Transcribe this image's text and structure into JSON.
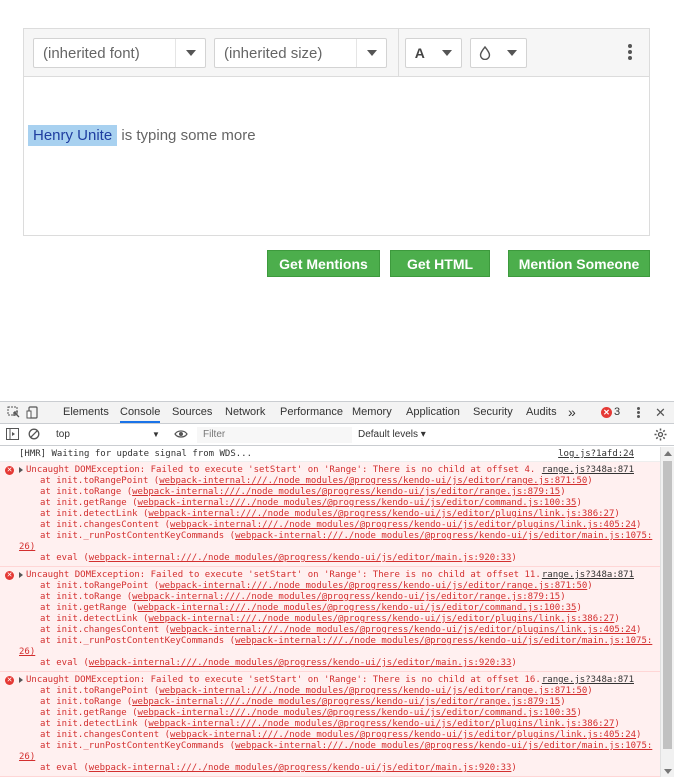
{
  "editor": {
    "font_dropdown": "(inherited font)",
    "size_dropdown": "(inherited size)",
    "fore_color_icon": "A",
    "mention_name": "Henry Unite",
    "content_text": " is typing some more"
  },
  "buttons": {
    "get_mentions": "Get Mentions",
    "get_html": "Get HTML",
    "mention_someone": "Mention Someone"
  },
  "devtools": {
    "tabs": [
      "Elements",
      "Console",
      "Sources",
      "Network",
      "Performance",
      "Memory",
      "Application",
      "Security",
      "Audits"
    ],
    "more_tabs": "»",
    "error_count": "3",
    "close": "✕",
    "context": "top",
    "filter_placeholder": "Filter",
    "levels": "Default levels ▾",
    "info_line": {
      "text": "[HMR] Waiting for update signal from WDS...",
      "src": "log.js?1afd:24"
    },
    "errors": [
      {
        "message": "Uncaught DOMException: Failed to execute 'setStart' on 'Range': There is no child at offset 4.",
        "src": "range.js?348a:871",
        "stack": [
          {
            "pre": "at init.toRangePoint (",
            "link": "webpack-internal:///./node_modules/@progress/kendo-ui/js/editor/range.js:871:50",
            "post": ")"
          },
          {
            "pre": "at init.toRange (",
            "link": "webpack-internal:///./node_modules/@progress/kendo-ui/js/editor/range.js:879:15",
            "post": ")"
          },
          {
            "pre": "at init.getRange (",
            "link": "webpack-internal:///./node_modules/@progress/kendo-ui/js/editor/command.js:100:35",
            "post": ")"
          },
          {
            "pre": "at init.detectLink (",
            "link": "webpack-internal:///./node_modules/@progress/kendo-ui/js/editor/plugins/link.js:386:27",
            "post": ")"
          },
          {
            "pre": "at init.changesContent (",
            "link": "webpack-internal:///./node_modules/@progress/kendo-ui/js/editor/plugins/link.js:405:24",
            "post": ")"
          },
          {
            "pre": "at init._runPostContentKeyCommands (",
            "link": "webpack-internal:///./node_modules/@progress/kendo-ui/js/editor/main.js:1075:",
            "post": ""
          },
          {
            "wrap": "26)"
          },
          {
            "pre": "at eval (",
            "link": "webpack-internal:///./node_modules/@progress/kendo-ui/js/editor/main.js:920:33",
            "post": ")"
          }
        ]
      },
      {
        "message": "Uncaught DOMException: Failed to execute 'setStart' on 'Range': There is no child at offset 11.",
        "src": "range.js?348a:871",
        "stack": [
          {
            "pre": "at init.toRangePoint (",
            "link": "webpack-internal:///./node_modules/@progress/kendo-ui/js/editor/range.js:871:50",
            "post": ")"
          },
          {
            "pre": "at init.toRange (",
            "link": "webpack-internal:///./node_modules/@progress/kendo-ui/js/editor/range.js:879:15",
            "post": ")"
          },
          {
            "pre": "at init.getRange (",
            "link": "webpack-internal:///./node_modules/@progress/kendo-ui/js/editor/command.js:100:35",
            "post": ")"
          },
          {
            "pre": "at init.detectLink (",
            "link": "webpack-internal:///./node_modules/@progress/kendo-ui/js/editor/plugins/link.js:386:27",
            "post": ")"
          },
          {
            "pre": "at init.changesContent (",
            "link": "webpack-internal:///./node_modules/@progress/kendo-ui/js/editor/plugins/link.js:405:24",
            "post": ")"
          },
          {
            "pre": "at init._runPostContentKeyCommands (",
            "link": "webpack-internal:///./node_modules/@progress/kendo-ui/js/editor/main.js:1075:",
            "post": ""
          },
          {
            "wrap": "26)"
          },
          {
            "pre": "at eval (",
            "link": "webpack-internal:///./node_modules/@progress/kendo-ui/js/editor/main.js:920:33",
            "post": ")"
          }
        ]
      },
      {
        "message": "Uncaught DOMException: Failed to execute 'setStart' on 'Range': There is no child at offset 16.",
        "src": "range.js?348a:871",
        "stack": [
          {
            "pre": "at init.toRangePoint (",
            "link": "webpack-internal:///./node_modules/@progress/kendo-ui/js/editor/range.js:871:50",
            "post": ")"
          },
          {
            "pre": "at init.toRange (",
            "link": "webpack-internal:///./node_modules/@progress/kendo-ui/js/editor/range.js:879:15",
            "post": ")"
          },
          {
            "pre": "at init.getRange (",
            "link": "webpack-internal:///./node_modules/@progress/kendo-ui/js/editor/command.js:100:35",
            "post": ")"
          },
          {
            "pre": "at init.detectLink (",
            "link": "webpack-internal:///./node_modules/@progress/kendo-ui/js/editor/plugins/link.js:386:27",
            "post": ")"
          },
          {
            "pre": "at init.changesContent (",
            "link": "webpack-internal:///./node_modules/@progress/kendo-ui/js/editor/plugins/link.js:405:24",
            "post": ")"
          },
          {
            "pre": "at init._runPostContentKeyCommands (",
            "link": "webpack-internal:///./node_modules/@progress/kendo-ui/js/editor/main.js:1075:",
            "post": ""
          },
          {
            "wrap": "26)"
          },
          {
            "pre": "at eval (",
            "link": "webpack-internal:///./node_modules/@progress/kendo-ui/js/editor/main.js:920:33",
            "post": ")"
          }
        ]
      }
    ]
  }
}
